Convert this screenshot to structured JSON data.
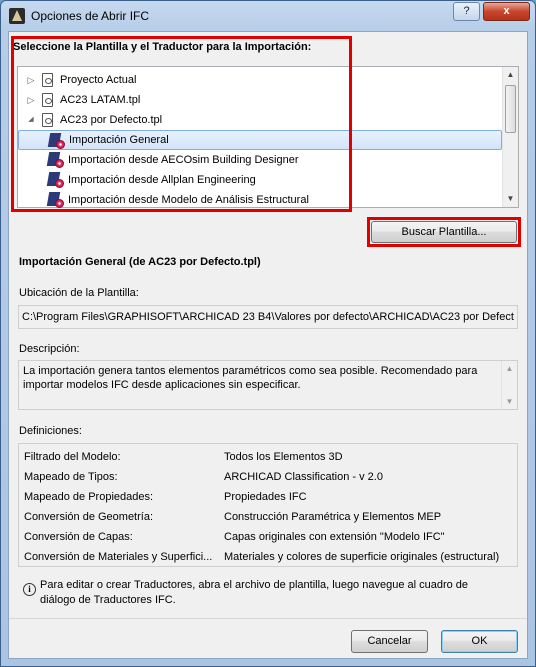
{
  "window": {
    "title": "Opciones de Abrir IFC",
    "help_label": "?",
    "close_label": "x"
  },
  "template_section": {
    "heading": "Seleccione la Plantilla y el Traductor para la Importación:",
    "items": [
      {
        "label": "Proyecto Actual",
        "kind": "file",
        "expander": "▷"
      },
      {
        "label": "AC23 LATAM.tpl",
        "kind": "file",
        "expander": "▷"
      },
      {
        "label": "AC23 por Defecto.tpl",
        "kind": "file",
        "expander": "◢"
      },
      {
        "label": "Importación General",
        "kind": "translator",
        "selected": true
      },
      {
        "label": "Importación desde AECOsim Building Designer",
        "kind": "translator"
      },
      {
        "label": "Importación desde Allplan Engineering",
        "kind": "translator"
      },
      {
        "label": "Importación desde Modelo de Análisis Estructural",
        "kind": "translator"
      }
    ]
  },
  "browse_button": "Buscar Plantilla...",
  "selected_title": "Importación General (de AC23 por Defecto.tpl)",
  "location": {
    "label": "Ubicación de la Plantilla:",
    "value": "C:\\Program Files\\GRAPHISOFT\\ARCHICAD 23 B4\\Valores por defecto\\ARCHICAD\\AC23 por Defect"
  },
  "description": {
    "label": "Descripción:",
    "text": "La importación genera tantos elementos paramétricos como sea posible. Recomendado para importar modelos IFC desde aplicaciones sin especificar."
  },
  "definitions": {
    "label": "Definiciones:",
    "rows": [
      {
        "name": "Filtrado del Modelo:",
        "value": "Todos los Elementos 3D"
      },
      {
        "name": "Mapeado de Tipos:",
        "value": "ARCHICAD Classification - v 2.0"
      },
      {
        "name": "Mapeado de Propiedades:",
        "value": "Propiedades IFC"
      },
      {
        "name": "Conversión de Geometría:",
        "value": "Construcción Paramétrica y Elementos MEP"
      },
      {
        "name": "Conversión de Capas:",
        "value": "Capas originales con extensión \"Modelo IFC\""
      },
      {
        "name": "Conversión de Materiales y Superfici...",
        "value": "Materiales y colores de superficie originales (estructural)"
      }
    ]
  },
  "info_note": {
    "icon": "i",
    "line1": "Para editar o crear Traductores, abra el archivo de plantilla, luego navegue al cuadro de",
    "line2": "diálogo de Traductores IFC."
  },
  "buttons": {
    "cancel": "Cancelar",
    "ok": "OK"
  },
  "colors": {
    "highlight_box": "#e00000",
    "selection": "#d3e4f9",
    "close_button": "#c8452e"
  }
}
